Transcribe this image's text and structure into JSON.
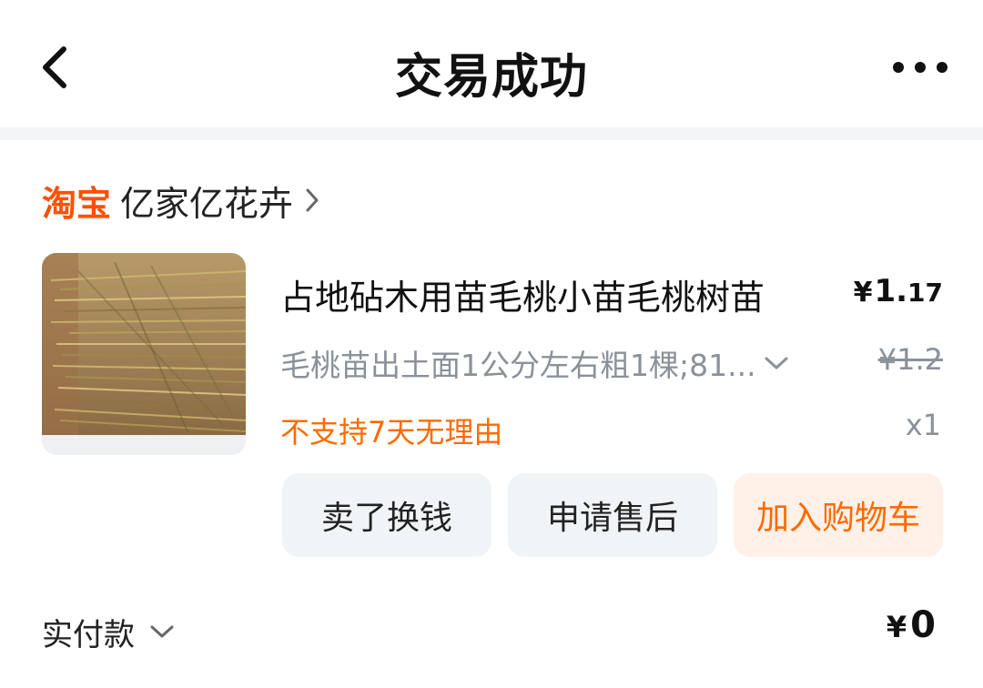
{
  "header": {
    "title": "交易成功",
    "back_icon": "chevron-left-icon",
    "more_icon": "more-horizontal-icon"
  },
  "shop": {
    "platform": "淘宝",
    "name": "亿家亿花卉",
    "chevron_icon": "chevron-right-icon"
  },
  "product": {
    "image_icon": "peach-seedlings-photo",
    "title": "占地砧木用苗毛桃小苗毛桃树苗",
    "price_currency": "¥",
    "price_int": "1.",
    "price_dec": "17",
    "sku": "毛桃苗出土面1公分左右粗1棵;81...",
    "original_price": "¥1.2",
    "notice": "不支持7天无理由",
    "quantity": "x1"
  },
  "actions": {
    "sell": "卖了换钱",
    "after_sale": "申请售后",
    "add_cart": "加入购物车"
  },
  "payment": {
    "label": "实付款",
    "currency": "¥",
    "amount": "0"
  },
  "colors": {
    "brand_orange": "#ff5000",
    "notice_orange": "#ff6a00",
    "cart_button_bg": "#fff1e8",
    "neutral_button_bg": "#f1f4f7",
    "muted_text": "#8a9199"
  }
}
